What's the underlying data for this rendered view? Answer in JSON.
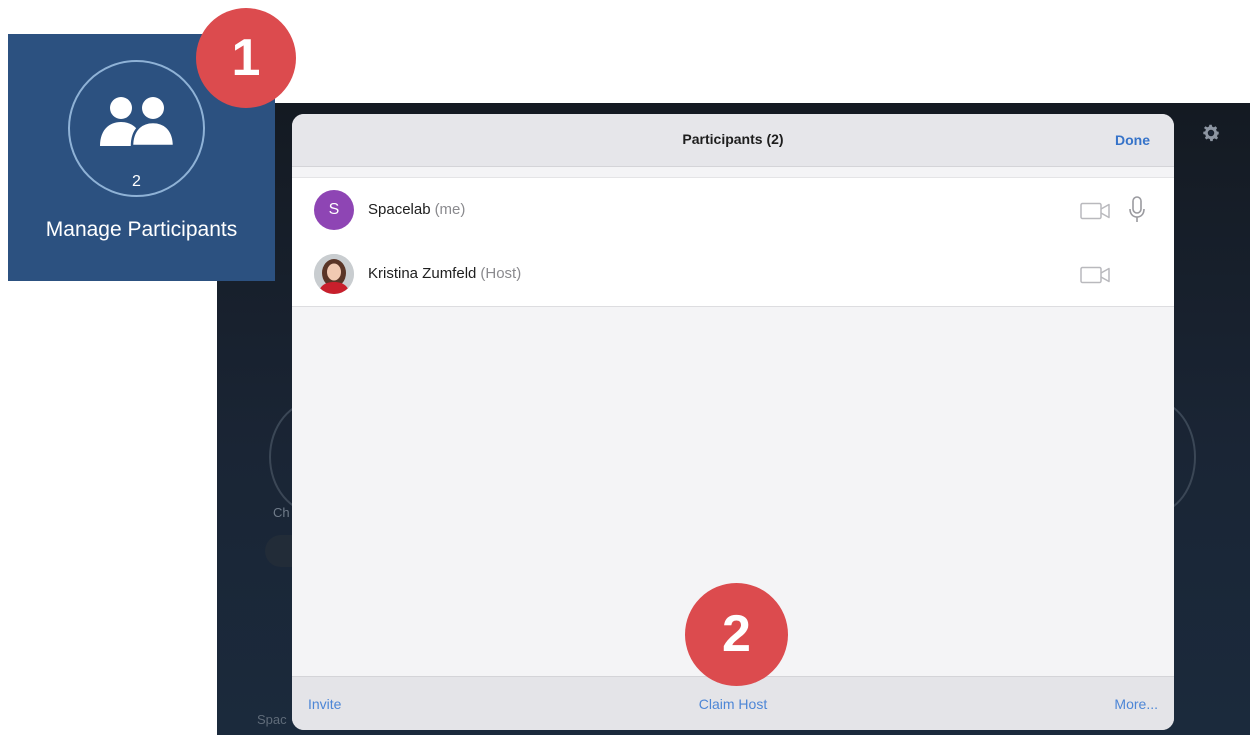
{
  "tile": {
    "participant_count": "2",
    "label": "Manage Participants"
  },
  "markers": [
    "1",
    "2"
  ],
  "modal": {
    "title": "Participants (2)",
    "done_label": "Done",
    "participants": [
      {
        "initial": "S",
        "name": "Spacelab",
        "role": "(me)",
        "video": "video-off-icon",
        "audio": "microphone-icon"
      },
      {
        "name": "Kristina Zumfeld",
        "role": "(Host)",
        "video": "video-off-icon"
      }
    ],
    "footer": {
      "invite_label": "Invite",
      "claim_host_label": "Claim Host",
      "more_label": "More..."
    }
  },
  "background": {
    "left_text": "Ch",
    "bottom_text": "Spac"
  },
  "colors": {
    "tile_bg": "#2c5180",
    "marker": "#dc4b4e",
    "accent": "#3673c9",
    "avatar_s": "#8e45b4"
  }
}
